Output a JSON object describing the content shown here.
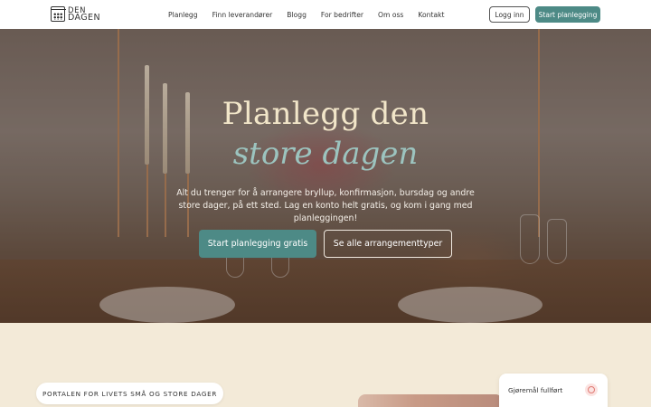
{
  "header": {
    "logo": {
      "line1": "DEN",
      "line2": "DAGEN",
      "icon": "calendar-icon"
    },
    "nav": [
      {
        "label": "Planlegg"
      },
      {
        "label": "Finn leverandører"
      },
      {
        "label": "Blogg"
      },
      {
        "label": "For bedrifter"
      },
      {
        "label": "Om oss"
      },
      {
        "label": "Kontakt"
      }
    ],
    "login_label": "Logg inn",
    "start_label": "Start planlegging"
  },
  "hero": {
    "title_line1": "Planlegg den",
    "title_line2": "store dagen",
    "subtitle": "Alt du trenger for å arrangere bryllup, konfirmasjon, bursdag og andre store dager, på ett sted. Lag en konto helt gratis, og kom i gang med planleggingen!",
    "primary_cta": "Start planlegging gratis",
    "secondary_cta": "Se alle arrangementtyper"
  },
  "section": {
    "pill_label": "PORTALEN FOR LIVETS SMÅ OG STORE DAGER",
    "task_card": {
      "label": "Gjøremål fullført",
      "icon": "target-icon"
    }
  },
  "colors": {
    "accent": "#4d8a86",
    "title_cream": "#f2e6c9",
    "title_teal": "#9cc4bf",
    "section_bg": "#f3ead8"
  }
}
